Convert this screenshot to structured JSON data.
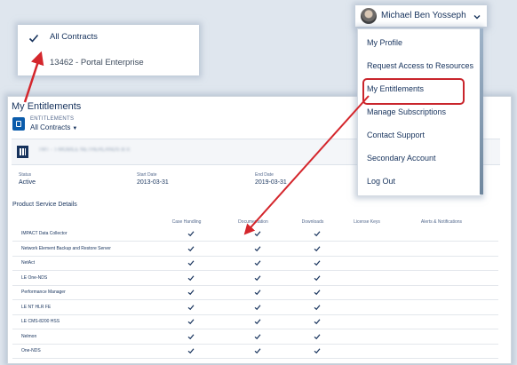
{
  "contract_dropdown": {
    "options": [
      {
        "label": "All Contracts",
        "selected": true
      },
      {
        "label": "13462 - Portal Enterprise",
        "selected": false
      }
    ]
  },
  "user_menu": {
    "user_name": "Michael Ben Yosseph",
    "items": [
      {
        "label": "My Profile"
      },
      {
        "label": "Request Access to Resources"
      },
      {
        "label": "My Entitlements",
        "highlighted": true
      },
      {
        "label": "Manage Subscriptions"
      },
      {
        "label": "Contact Support"
      },
      {
        "label": "Secondary Account"
      },
      {
        "label": "Log Out"
      }
    ]
  },
  "page": {
    "title": "My Entitlements",
    "entitlements_label": "ENTITLEMENTS",
    "entitlements_value": "All Contracts",
    "account_name": "TMT - T-MOBILE NETHERLANDS B.V.",
    "meta": {
      "status_label": "Status",
      "status_value": "Active",
      "start_label": "Start Date",
      "start_value": "2013-03-31",
      "end_label": "End Date",
      "end_value": "2019-03-31"
    },
    "product_section_title": "Product Service Details",
    "columns": [
      "Case Handling",
      "Documentation",
      "Downloads",
      "License Keys",
      "Alerts & Notifications"
    ],
    "products": [
      {
        "name": "IMPACT Data Collector",
        "case_handling": true,
        "documentation": true,
        "downloads": true
      },
      {
        "name": "Network Element Backup and Restore Server",
        "case_handling": true,
        "documentation": true,
        "downloads": true
      },
      {
        "name": "NetAct",
        "case_handling": true,
        "documentation": true,
        "downloads": true
      },
      {
        "name": "LE One-NDS",
        "case_handling": true,
        "documentation": true,
        "downloads": true
      },
      {
        "name": "Performance Manager",
        "case_handling": true,
        "documentation": true,
        "downloads": true
      },
      {
        "name": "LE NT HLR FE",
        "case_handling": true,
        "documentation": true,
        "downloads": true
      },
      {
        "name": "LE CMS-8200 HSS",
        "case_handling": true,
        "documentation": true,
        "downloads": true
      },
      {
        "name": "Nelmon",
        "case_handling": true,
        "documentation": true,
        "downloads": true
      },
      {
        "name": "One-NDS",
        "case_handling": true,
        "documentation": true,
        "downloads": true
      }
    ]
  },
  "colors": {
    "accent_red": "#c9252c",
    "brand_blue": "#0b5cab",
    "check_color": "#16325c"
  },
  "icons": {
    "checkmark": "checkmark-icon",
    "entitlements": "entitlements-icon",
    "account": "building-icon",
    "chevron": "chevron-down-icon",
    "avatar": "user-avatar"
  }
}
